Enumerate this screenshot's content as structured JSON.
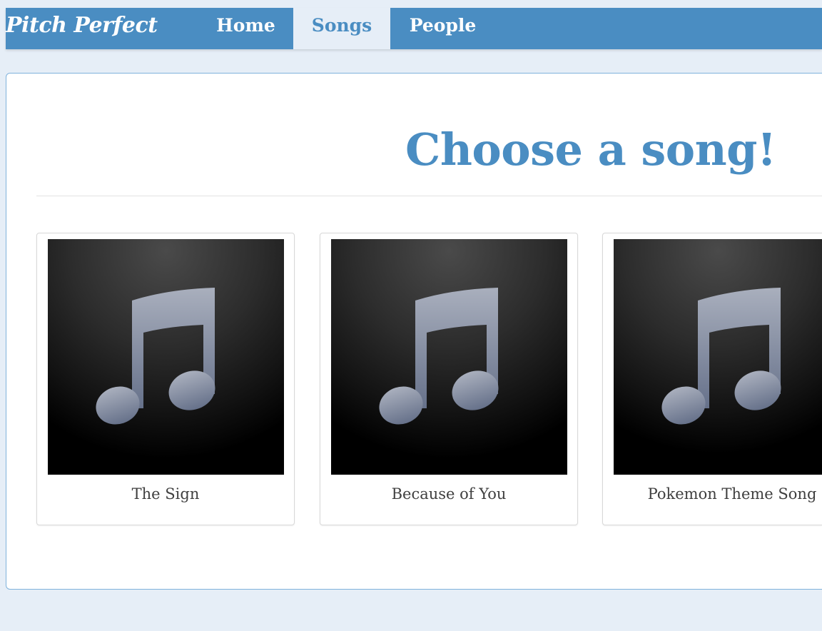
{
  "navbar": {
    "brand": "Pitch Perfect",
    "tabs": [
      {
        "label": "Home",
        "active": false
      },
      {
        "label": "Songs",
        "active": true
      },
      {
        "label": "People",
        "active": false
      }
    ]
  },
  "main": {
    "title": "Choose a song!",
    "songs": [
      {
        "title": "The Sign",
        "icon": "music-note-icon"
      },
      {
        "title": "Because of You",
        "icon": "music-note-icon"
      },
      {
        "title": "Pokemon Theme Song",
        "icon": "music-note-icon"
      }
    ]
  },
  "colors": {
    "accent": "#4a8dc2",
    "background": "#e6eef7",
    "card_border": "#d8d8d8",
    "text": "#3f3f3f"
  }
}
